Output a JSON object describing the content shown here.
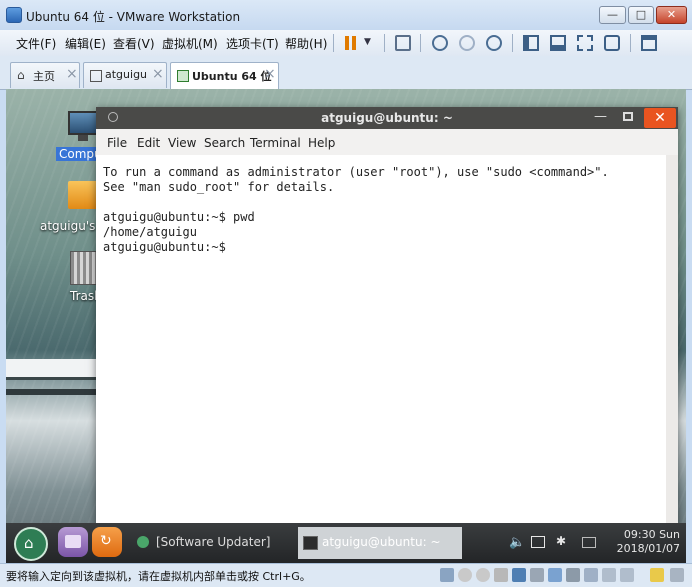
{
  "vmware": {
    "title": "Ubuntu 64 位 - VMware Workstation",
    "menu": [
      "文件(F)",
      "编辑(E)",
      "查看(V)",
      "虚拟机(M)",
      "选项卡(T)",
      "帮助(H)"
    ],
    "tabs": [
      {
        "label": "主页",
        "icon": "home-icon"
      },
      {
        "label": "atguigu",
        "icon": "vm-icon"
      },
      {
        "label": "Ubuntu 64 位",
        "icon": "vm-icon",
        "active": true
      }
    ],
    "status_text": "要将输入定向到该虚拟机，请在虚拟机内部单击或按 Ctrl+G。"
  },
  "desktop": {
    "icons": [
      {
        "label": "Computer",
        "icon": "computer-icon"
      },
      {
        "label": "atguigu's Home",
        "icon": "folder-icon"
      },
      {
        "label": "Trash",
        "icon": "trash-icon"
      }
    ]
  },
  "terminal": {
    "title": "atguigu@ubuntu: ~",
    "menu": [
      "File",
      "Edit",
      "View",
      "Search",
      "Terminal",
      "Help"
    ],
    "lines": [
      "To run a command as administrator (user \"root\"), use \"sudo <command>\".",
      "See \"man sudo_root\" for details.",
      "",
      "atguigu@ubuntu:~$ pwd",
      "/home/atguigu",
      "atguigu@ubuntu:~$"
    ]
  },
  "panel": {
    "tasks": [
      {
        "label": "[Software Updater]",
        "icon": "software-updater-icon"
      },
      {
        "label": "atguigu@ubuntu: ~",
        "icon": "terminal-icon",
        "active": true
      }
    ],
    "time": "09:30 Sun",
    "date": "2018/01/07"
  },
  "colors": {
    "terminal_titlebar": "#4a4a48",
    "terminal_close": "#e95420",
    "selected_icon_label": "#3875d7"
  }
}
